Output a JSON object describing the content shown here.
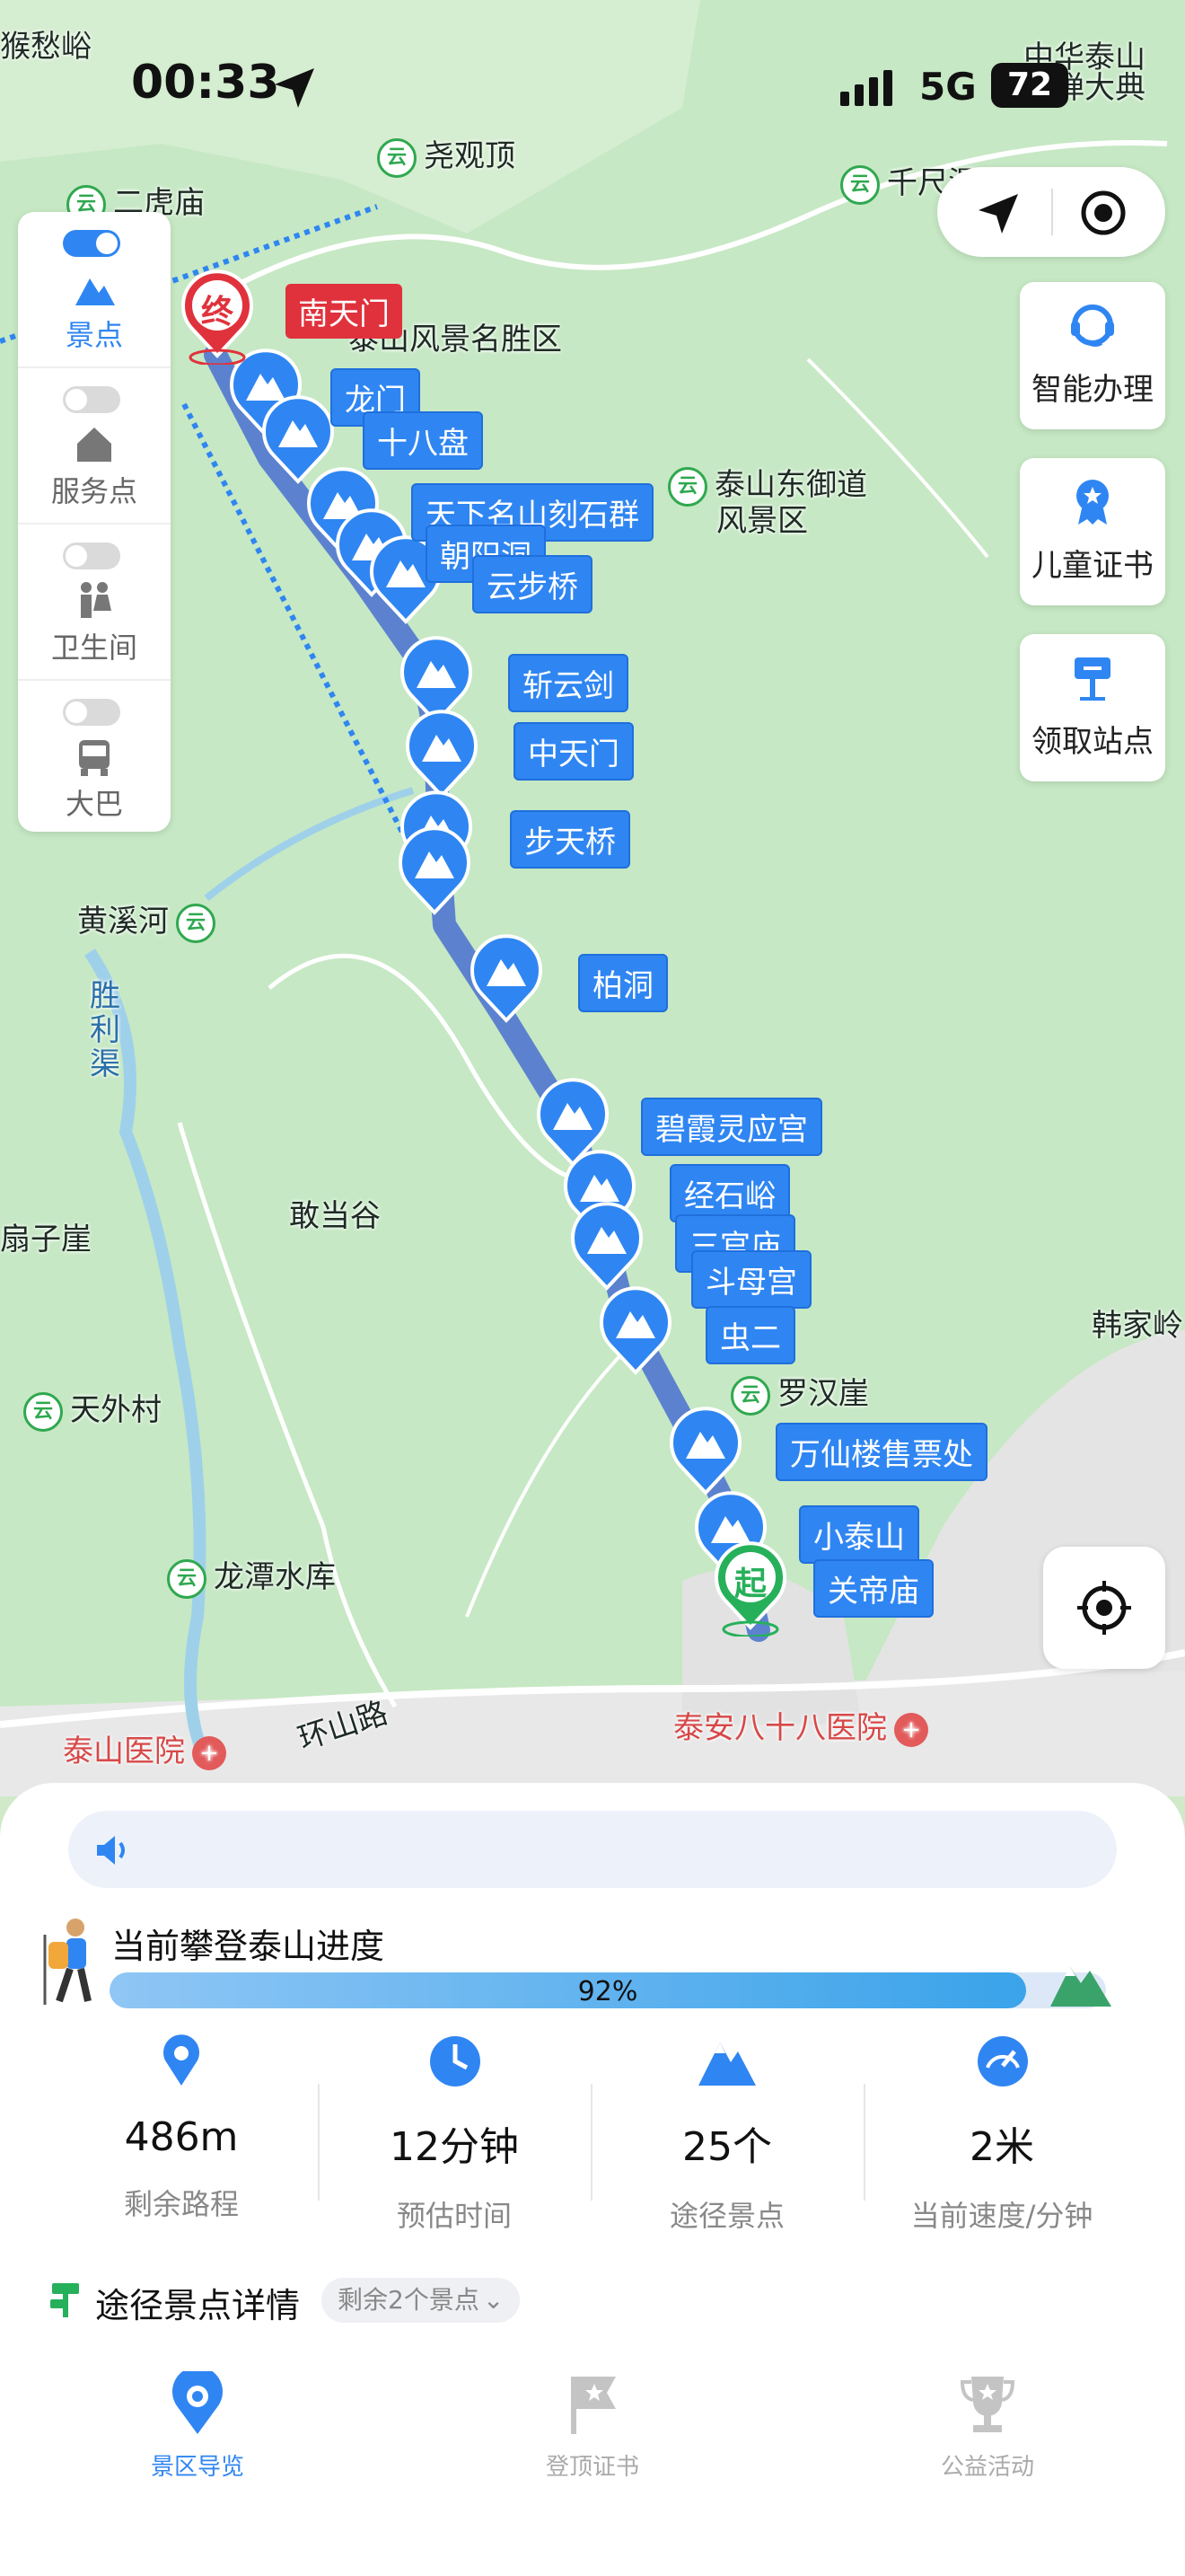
{
  "status_bar": {
    "time": "00:33",
    "network": "5G",
    "battery": "72"
  },
  "map": {
    "places": [
      "猴愁峪",
      "中华泰山",
      "封禅大典",
      "尧观顶",
      "千尺瀑",
      "二虎庙",
      "泰山风景名胜区",
      "泰山东御道",
      "风景区",
      "黄溪河",
      "胜利渠",
      "敢当谷",
      "扇子崖",
      "韩家岭",
      "天外村",
      "罗汉崖",
      "龙潭水库",
      "环山路",
      "泰山医院",
      "泰安八十八医院"
    ],
    "start_marker": "起",
    "end_marker": "终",
    "end_name": "南天门",
    "spots": [
      "龙门",
      "十八盘",
      "天下名山刻石群",
      "朝阳洞",
      "云步桥",
      "斩云剑",
      "中天门",
      "步天桥",
      "柏洞",
      "碧霞灵应宫",
      "经石峪",
      "三官庙",
      "斗母宫",
      "虫二",
      "万仙楼售票处",
      "小泰山",
      "关帝庙"
    ],
    "layers": [
      {
        "label": "景点",
        "on": true,
        "icon": "mountain-icon"
      },
      {
        "label": "服务点",
        "on": false,
        "icon": "house-icon"
      },
      {
        "label": "卫生间",
        "on": false,
        "icon": "restroom-icon"
      },
      {
        "label": "大巴",
        "on": false,
        "icon": "bus-icon"
      }
    ],
    "actions": [
      "智能办理",
      "儿童证书",
      "领取站点"
    ]
  },
  "progress": {
    "title": "当前攀登泰山进度",
    "percent_text": "92%",
    "value": 0.92
  },
  "stats": [
    {
      "value": "486m",
      "label": "剩余路程",
      "icon": "location-pin-icon"
    },
    {
      "value": "12分钟",
      "label": "预估时间",
      "icon": "clock-icon"
    },
    {
      "value": "25个",
      "label": "途径景点",
      "icon": "mountain-icon"
    },
    {
      "value": "2米",
      "label": "当前速度/分钟",
      "icon": "speedometer-icon"
    }
  ],
  "details": {
    "title": "途径景点详情",
    "badge": "剩余2个景点"
  },
  "tabs": [
    {
      "label": "景区导览",
      "active": true,
      "icon": "map-pin-icon"
    },
    {
      "label": "登顶证书",
      "active": false,
      "icon": "flag-icon"
    },
    {
      "label": "公益活动",
      "active": false,
      "icon": "trophy-icon"
    }
  ],
  "colors": {
    "accent": "#2f86f2",
    "route": "#5c82cf",
    "start": "#27b05a",
    "end": "#e0323c"
  }
}
